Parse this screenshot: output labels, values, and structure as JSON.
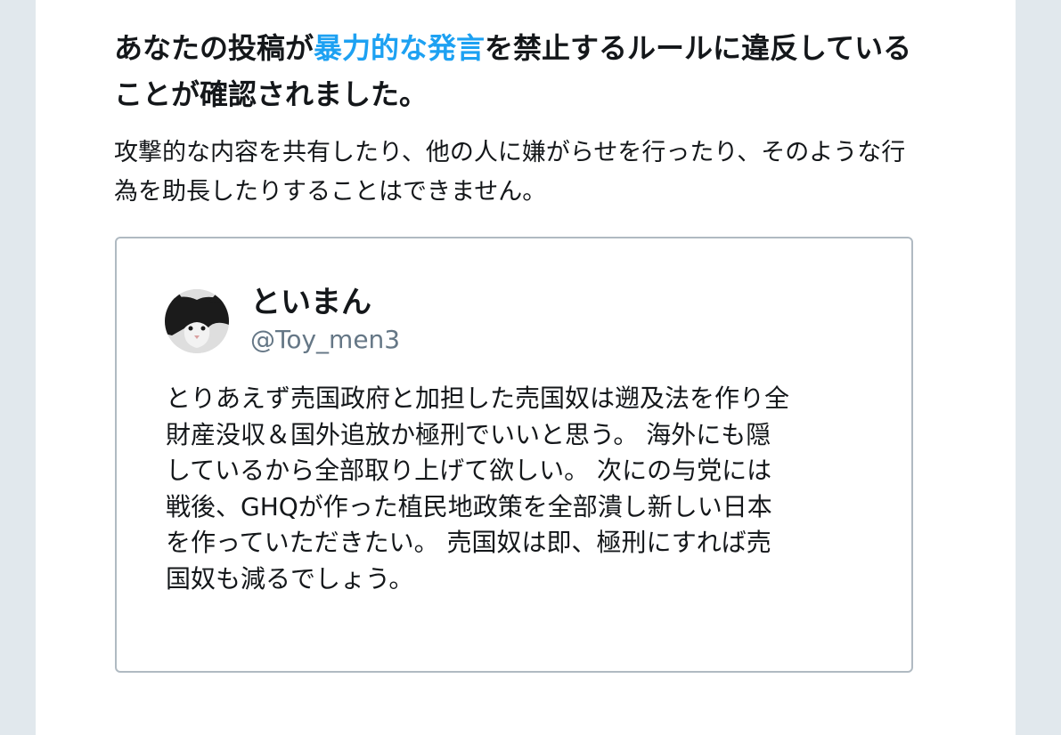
{
  "notice": {
    "heading_prefix": "あなたの投稿が",
    "heading_highlight": "暴力的な発言",
    "heading_suffix": "を禁止するルールに違反していることが確認されました。",
    "description": "攻撃的な内容を共有したり、他の人に嫌がらせを行ったり、そのような行為を助長したりすることはできません。"
  },
  "tweet": {
    "display_name": "といまん",
    "handle": "@Toy_men3",
    "avatar_icon": "cat-avatar-icon",
    "text": "とりあえず売国政府と加担した売国奴は遡及法を作り全\n財産没収＆国外追放か極刑でいいと思う。 海外にも隠\nしているから全部取り上げて欲しい。 次にの与党には\n戦後、GHQが作った植民地政策を全部潰し新しい日本\nを作っていただきたい。 売国奴は即、極刑にすれば売\n国奴も減るでしょう。"
  },
  "colors": {
    "highlight": "#1da1f2",
    "text": "#14171a",
    "secondary_text": "#657786",
    "card_border": "#b0bac2",
    "page_background": "#e1e8ed"
  }
}
